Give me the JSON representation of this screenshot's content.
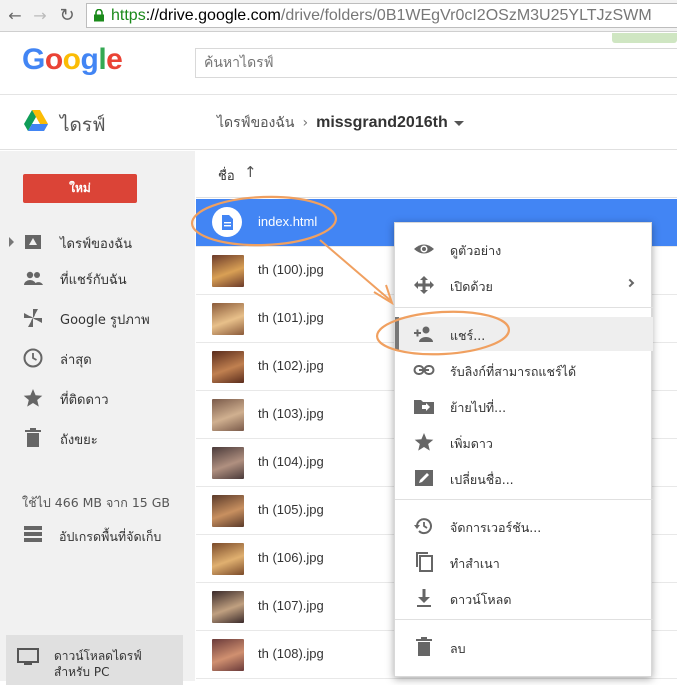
{
  "browser": {
    "url_scheme": "https",
    "url_host": "://drive.google.com",
    "url_path": "/drive/folders/0B1WEgVr0cI2OSzM3U25YLTJzSWM"
  },
  "google": {
    "logo_letters": [
      "G",
      "o",
      "o",
      "g",
      "l",
      "e"
    ],
    "logo_colors": [
      "#4285f4",
      "#ea4335",
      "#fbbc05",
      "#4285f4",
      "#34a853",
      "#ea4335"
    ],
    "search_placeholder": "ค้นหาไดรฟ์"
  },
  "drive": {
    "title": "ไดรฟ์",
    "breadcrumb_root": "ไดรฟ์ของฉัน",
    "breadcrumb_current": "missgrand2016th"
  },
  "sidebar": {
    "new_label": "ใหม่",
    "items": [
      {
        "label": "ไดรฟ์ของฉัน",
        "icon": "my-drive-icon"
      },
      {
        "label": "ที่แชร์กับฉัน",
        "icon": "shared-people-icon"
      },
      {
        "label": "Google รูปภาพ",
        "icon": "photos-pinwheel-icon"
      },
      {
        "label": "ล่าสุด",
        "icon": "clock-icon"
      },
      {
        "label": "ที่ติดดาว",
        "icon": "star-icon"
      },
      {
        "label": "ถังขยะ",
        "icon": "trash-icon"
      }
    ],
    "storage": "ใช้ไป 466 MB จาก 15 GB",
    "upgrade": "อัปเกรดพื้นที่จัดเก็บ",
    "download_pc_line1": "ดาวน์โหลดไดรฟ์",
    "download_pc_line2": "สำหรับ PC"
  },
  "list": {
    "header_label": "ชื่อ",
    "sort_arrow": "↑",
    "files": [
      {
        "name": "index.html",
        "type": "doc"
      },
      {
        "name": "th (100).jpg",
        "type": "image"
      },
      {
        "name": "th (101).jpg",
        "type": "image"
      },
      {
        "name": "th (102).jpg",
        "type": "image"
      },
      {
        "name": "th (103).jpg",
        "type": "image"
      },
      {
        "name": "th (104).jpg",
        "type": "image"
      },
      {
        "name": "th (105).jpg",
        "type": "image"
      },
      {
        "name": "th (106).jpg",
        "type": "image"
      },
      {
        "name": "th (107).jpg",
        "type": "image"
      },
      {
        "name": "th (108).jpg",
        "type": "image"
      }
    ]
  },
  "menu": {
    "items": [
      {
        "label": "ดูตัวอย่าง",
        "icon": "eye-icon"
      },
      {
        "label": "เปิดด้วย",
        "icon": "move-arrows-icon"
      },
      {
        "label": "แชร์...",
        "icon": "add-person-icon"
      },
      {
        "label": "รับลิงก์ที่สามารถแชร์ได้",
        "icon": "link-icon"
      },
      {
        "label": "ย้ายไปที่...",
        "icon": "folder-move-icon"
      },
      {
        "label": "เพิ่มดาว",
        "icon": "star-icon"
      },
      {
        "label": "เปลี่ยนชื่อ...",
        "icon": "pencil-icon"
      },
      {
        "label": "จัดการเวอร์ชัน...",
        "icon": "history-icon"
      },
      {
        "label": "ทำสำเนา",
        "icon": "copy-icon"
      },
      {
        "label": "ดาวน์โหลด",
        "icon": "download-icon"
      },
      {
        "label": "ลบ",
        "icon": "trash-icon"
      }
    ]
  },
  "colors": {
    "selected_row": "#4285f4",
    "new_button": "#db4437",
    "annotation": "#f0a060"
  }
}
